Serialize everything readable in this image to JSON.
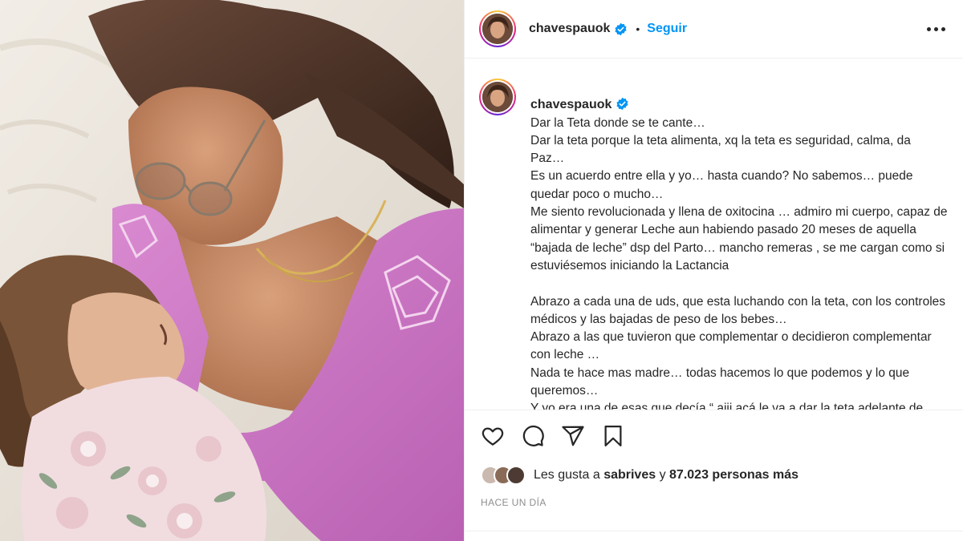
{
  "post": {
    "username": "chavespauok",
    "follow_label": "Seguir",
    "dot": "•"
  },
  "caption": {
    "username": "chavespauok",
    "lines": [
      "Dar la Teta donde se te cante…",
      "Dar la teta porque la teta alimenta, xq la teta es seguridad, calma, da Paz…",
      "Es un acuerdo entre ella y yo… hasta cuando? No sabemos… puede quedar poco o mucho…",
      "Me siento revolucionada y llena de oxitocina … admiro mi cuerpo, capaz de alimentar y generar Leche aun habiendo pasado 20 meses de aquella “bajada de leche” dsp del Parto… mancho remeras , se me cargan como si estuviésemos iniciando la Lactancia",
      "",
      "Abrazo a cada una de uds, que esta luchando con la teta, con los controles médicos y las bajadas de peso de los bebes…",
      "Abrazo a las que tuvieron que complementar o decidieron complementar con leche …",
      "Nada te hace mas madre… todas hacemos lo que podemos y lo que queremos…",
      "Y yo era una de esas que decía “ aiii acá le va a dar la teta adelante de todos?”"
    ]
  },
  "likes": {
    "prefix": "Les gusta a",
    "user": "sabrives",
    "connector": "y",
    "count": "87.023 personas más"
  },
  "timestamp": "HACE UN DÍA",
  "icons": {
    "verified": "verified-badge-icon",
    "like": "heart-icon",
    "comment": "comment-icon",
    "share": "paper-plane-icon",
    "save": "bookmark-icon",
    "more": "more-options-icon"
  },
  "colors": {
    "accent": "#0095f6",
    "text": "#262626",
    "muted": "#8e8e8e",
    "divider": "#efefef"
  }
}
